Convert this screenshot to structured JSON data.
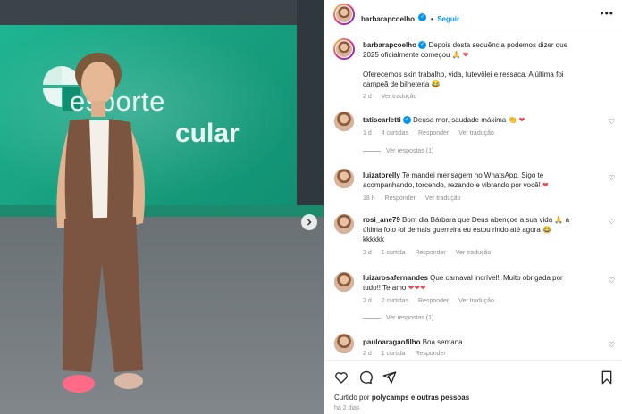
{
  "post": {
    "author": "barbarapcoelho",
    "follow_label": "Seguir",
    "caption_line1": "Depois desta sequência podemos dizer que",
    "caption_line2": "2025 oficialmente começou",
    "caption_emoji": "🙏 ❤",
    "caption_p2_line1": "Oferecemos skin trabalho, vida, futevôlei e ressaca. A última foi",
    "caption_p2_line2": "campeã de bilheteria",
    "caption_p2_emoji": "😂",
    "caption_time": "2 d",
    "caption_translate": "Ver tradução",
    "photo_logo_line1": "esporte",
    "photo_logo_line2": "cular"
  },
  "comments": [
    {
      "user": "tatiscarletti",
      "verified": true,
      "text": "Deusa mor, saudade máxima",
      "emoji": "👏 ❤",
      "time": "1 d",
      "likes": "4 curtidas",
      "reply": "Responder",
      "translate": "Ver tradução",
      "replies": "Ver respostas (1)"
    },
    {
      "user": "luizatorelly",
      "text_line1": "Te mandei mensagem no WhatsApp. Sigo te",
      "text_line2": "acompanhando, torcendo, rezando e vibrando por você!",
      "emoji": "❤",
      "time": "18 h",
      "reply": "Responder",
      "translate": "Ver tradução"
    },
    {
      "user": "rosi_ane79",
      "text_line1": "Bom dia Bárbara que Deus abençoe a sua vida",
      "text_line1_emoji": "🙏 a",
      "text_line2": "última foto foi demais guerreira eu estou rindo até agora",
      "text_line2_emoji": "😂",
      "text_line3": "kkkkkk",
      "time": "2 d",
      "likes": "1 curtida",
      "reply": "Responder",
      "translate": "Ver tradução"
    },
    {
      "user": "luizarosafernandes",
      "text_line1": "Que carnaval incrível!! Muito obrigada por",
      "text_line2": "tudo!! Te amo",
      "emoji": "❤❤❤",
      "time": "2 d",
      "likes": "2 curtidas",
      "reply": "Responder",
      "translate": "Ver tradução",
      "replies": "Ver respostas (1)"
    },
    {
      "user": "pauloaragaofilho",
      "text": "Boa semana",
      "time": "2 d",
      "likes": "1 curtida",
      "reply": "Responder"
    }
  ],
  "footer": {
    "liked_by_prefix": "Curtido por",
    "liked_by_user": "polycamps",
    "liked_by_suffix": "e outras pessoas",
    "time_ago": "há 2 dias"
  },
  "icons": [
    "heart-icon",
    "comment-icon",
    "share-icon",
    "bookmark-icon",
    "more-options-icon",
    "chevron-right-icon",
    "verified-icon"
  ],
  "colors": {
    "link_blue": "#0095f6",
    "meta_gray": "#8e8e8e",
    "studio_green": "#18a07f",
    "heart_red": "#ed4956"
  }
}
